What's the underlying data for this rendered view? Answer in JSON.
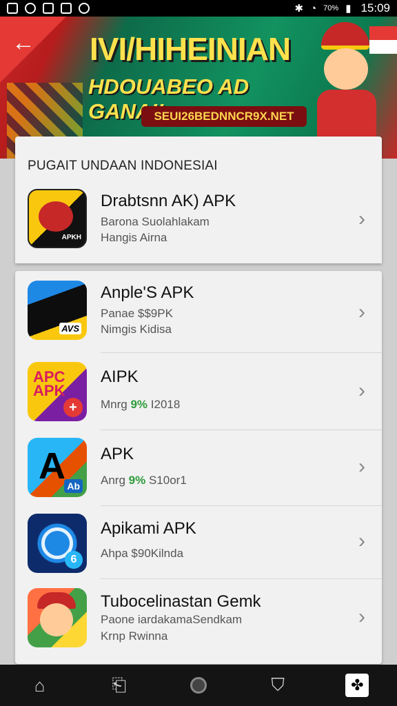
{
  "status_bar": {
    "time": "15:09",
    "signal_text": "70%",
    "left_icons": [
      "notification-icon",
      "messenger-icon",
      "app-icon",
      "instagram-icon",
      "photo-icon"
    ],
    "right_icons": [
      "bluetooth-icon",
      "wifi-icon",
      "signal-icon",
      "battery-icon"
    ]
  },
  "banner": {
    "title_line1": "IVI/HIHEINIAN",
    "title_line2": "HDOUABEO AD GANAI!",
    "url": "SEUI26BEDNNCR9X.NET",
    "back_icon": "back-arrow-icon"
  },
  "section_title": "PUGAIT UNDAAN INDONESIAI",
  "apps": [
    {
      "name": "Drabtsnn AK)  APK",
      "line1": "Barona Suolahlakam",
      "line2": "Hangis Airna",
      "icon_label": "APKH"
    },
    {
      "name": "Anple'S APK",
      "line1": "Panae $$9PK",
      "line2": "Nimgis Kidisa",
      "icon_label": "AVS"
    },
    {
      "name": "AIPK",
      "line1_prefix": "Mnrg",
      "line1_highlight": "9%",
      "line1_suffix": " I2018",
      "icon_label": "APC APK"
    },
    {
      "name": "APK",
      "line1_prefix": "Anrg",
      "line1_highlight": "9%",
      "line1_suffix": " S10or1",
      "icon_label": "Ab"
    },
    {
      "name": "Apikami APK",
      "line1": "Ahpa $90Kilnda",
      "icon_label": "6"
    },
    {
      "name": "Tubocelinastan Gemk",
      "line1": "Paone iardakamaSendkam",
      "line2": "Krnp Rwinna",
      "icon_label": ""
    }
  ],
  "nav_bar": {
    "items": [
      "home-icon",
      "back-icon",
      "circle-icon",
      "shield-icon",
      "app-switch-icon"
    ]
  },
  "colors": {
    "banner_red": "#c62828",
    "banner_green": "#12925f",
    "title_yellow": "#ffe14d",
    "highlight_green": "#2e9b3a"
  }
}
